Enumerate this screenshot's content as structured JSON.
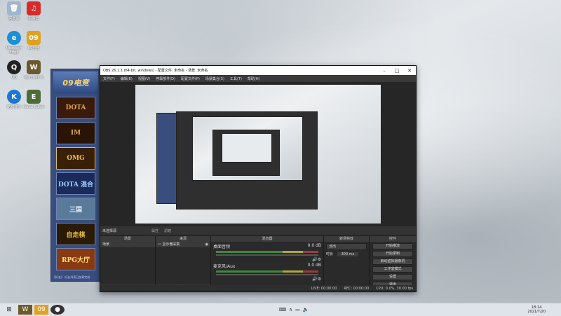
{
  "desktop": {
    "icons": [
      {
        "label": "回收站",
        "icon": "recycle-bin-icon"
      },
      {
        "label": "网易云",
        "icon": "netease-music-icon"
      },
      {
        "label": "Microsoft Edge",
        "icon": "edge-icon"
      },
      {
        "label": "09电竞",
        "icon": "09-gaming-icon"
      },
      {
        "label": "QQ",
        "icon": "qq-icon"
      },
      {
        "label": "Warcraft III",
        "icon": "warcraft-icon"
      },
      {
        "label": "酷狗音乐",
        "icon": "kugou-icon"
      },
      {
        "label": "World Editor",
        "icon": "world-editor-icon"
      }
    ]
  },
  "game_panel": {
    "logo": "09电竞",
    "tiles": [
      "DOTA",
      "IM",
      "OMG",
      "DOTA 混合",
      "三国",
      "自走棋",
      "RPG大厅"
    ],
    "footer": "【好友】 好友列表已加载完成"
  },
  "obs": {
    "title": "OBS 26.1.1 (64-bit, windows) - 配置文件: 未命名 - 场景: 未命名",
    "menu": [
      "文件(F)",
      "编辑(E)",
      "视图(V)",
      "停靠部件(D)",
      "配置文件(P)",
      "场景集合(S)",
      "工具(T)",
      "帮助(H)"
    ],
    "source_bar": {
      "label": "未选择源",
      "props": "属性",
      "filters": "滤镜"
    },
    "docks": {
      "scenes": {
        "title": "场景",
        "items": [
          "场景"
        ]
      },
      "sources": {
        "title": "来源",
        "items": [
          "显示器采集"
        ]
      },
      "mixer": {
        "title": "混音器",
        "channels": [
          {
            "name": "桌面音频",
            "db": "0.0 dB"
          },
          {
            "name": "麦克风/Aux",
            "db": "0.0 dB"
          }
        ]
      },
      "transitions": {
        "title": "转场特效",
        "type": "淡出",
        "duration_label": "时长",
        "duration": "300 ms"
      },
      "controls": {
        "title": "控件",
        "buttons": [
          "开始推流",
          "开始录制",
          "启动虚拟摄像机",
          "工作室模式",
          "设置",
          "退出"
        ]
      }
    },
    "status": {
      "live": "LIVE: 00:00:00",
      "rec": "REC: 00:00:00",
      "cpu": "CPU: 0.0%, 30.00 fps"
    }
  },
  "taskbar": {
    "time": "18:14",
    "date": "2021/7/20"
  },
  "colors": {
    "obs_bg": "#2b2b2b",
    "game_panel": "#3a4e7e",
    "taskbar": "#dfe4ea"
  }
}
